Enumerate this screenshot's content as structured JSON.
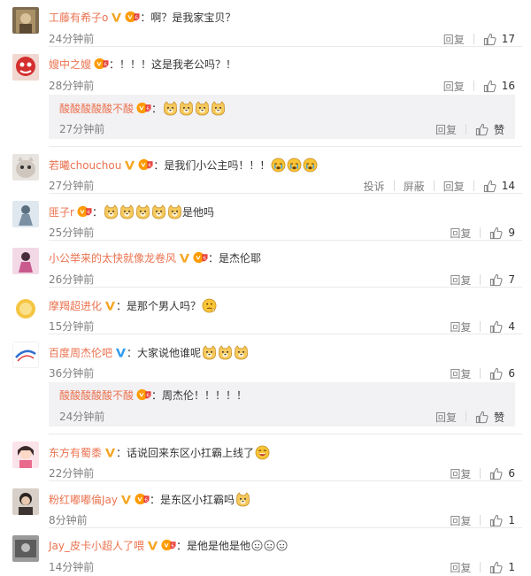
{
  "labels": {
    "reply": "回复",
    "report": "投诉",
    "block": "屏蔽",
    "like": "赞"
  },
  "colors": {
    "username": "#eb7350",
    "time": "#808080",
    "reply_bg": "#f2f2f5",
    "verified": "#f5a623",
    "verified_blue": "#2f9bf0"
  },
  "comments": [
    {
      "user": "工藤有希子o",
      "badge": "v-yellow",
      "vip": true,
      "text": "：啊？是我家宝贝？",
      "emojis": [],
      "time": "24分钟前",
      "likes": "17",
      "avatar": "avatar-sepia"
    },
    {
      "user": "嫂中之嫂",
      "badge": "",
      "vip": true,
      "text": "：！！！这是我老公吗？！",
      "emojis": [],
      "time": "28分钟前",
      "likes": "16",
      "avatar": "avatar-red"
    },
    {
      "user": "若曦chouchou",
      "badge": "v-yellow",
      "vip": true,
      "text": "：是我们小公主吗！！！",
      "emojis": [
        "tearface",
        "tearface",
        "tearface"
      ],
      "time": "27分钟前",
      "likes": "14",
      "avatar": "avatar-cat",
      "extra": true
    },
    {
      "user": "匪子r",
      "badge": "",
      "vip": true,
      "text": "：",
      "emojis": [
        "doge",
        "doge",
        "doge",
        "doge",
        "doge"
      ],
      "text_after": "是他吗",
      "time": "25分钟前",
      "likes": "9",
      "avatar": "avatar-figure"
    },
    {
      "user": "小公举来的太快就像龙卷风",
      "badge": "v-yellow",
      "vip": true,
      "text": "：是杰伦耶",
      "emojis": [],
      "time": "26分钟前",
      "likes": "7",
      "avatar": "avatar-pink"
    },
    {
      "user": "摩羯超进化",
      "badge": "v-yellow",
      "vip": false,
      "text": "：是那个男人吗？",
      "emojis": [
        "think"
      ],
      "time": "15分钟前",
      "likes": "4",
      "avatar": "avatar-yellow"
    },
    {
      "user": "百度周杰伦吧",
      "badge": "v-blue",
      "vip": false,
      "text": "：大家说他谁呢",
      "emojis": [
        "doge",
        "doge",
        "doge"
      ],
      "time": "36分钟前",
      "likes": "6",
      "avatar": "avatar-logo"
    },
    {
      "user": "东方有蜀黍",
      "badge": "v-yellow",
      "vip": false,
      "text": "：话说回来东区小扛霸上线了",
      "emojis": [
        "laugh"
      ],
      "time": "22分钟前",
      "likes": "6",
      "avatar": "avatar-girl"
    },
    {
      "user": "粉红嘟嘟倫Jay",
      "badge": "v-yellow",
      "vip": true,
      "text": "：是东区小扛霸吗",
      "emojis": [
        "doge"
      ],
      "time": "8分钟前",
      "likes": "1",
      "avatar": "avatar-dark"
    },
    {
      "user": "Jay_皮卡小超人了喂",
      "badge": "v-yellow",
      "vip": true,
      "text": "：是他是他是他",
      "emojis": [
        "smallface",
        "smallface",
        "smallface"
      ],
      "time": "14分钟前",
      "likes": "1",
      "avatar": "avatar-gray"
    }
  ],
  "replies": [
    {
      "user": "酸酸酸酸酸不酸",
      "vip": true,
      "text": "：",
      "emojis": [
        "doge",
        "doge",
        "doge",
        "doge"
      ],
      "time": "27分钟前"
    },
    {
      "user": "酸酸酸酸酸不酸",
      "vip": true,
      "text": "：周杰伦！！！！！",
      "emojis": [],
      "time": "24分钟前"
    }
  ]
}
